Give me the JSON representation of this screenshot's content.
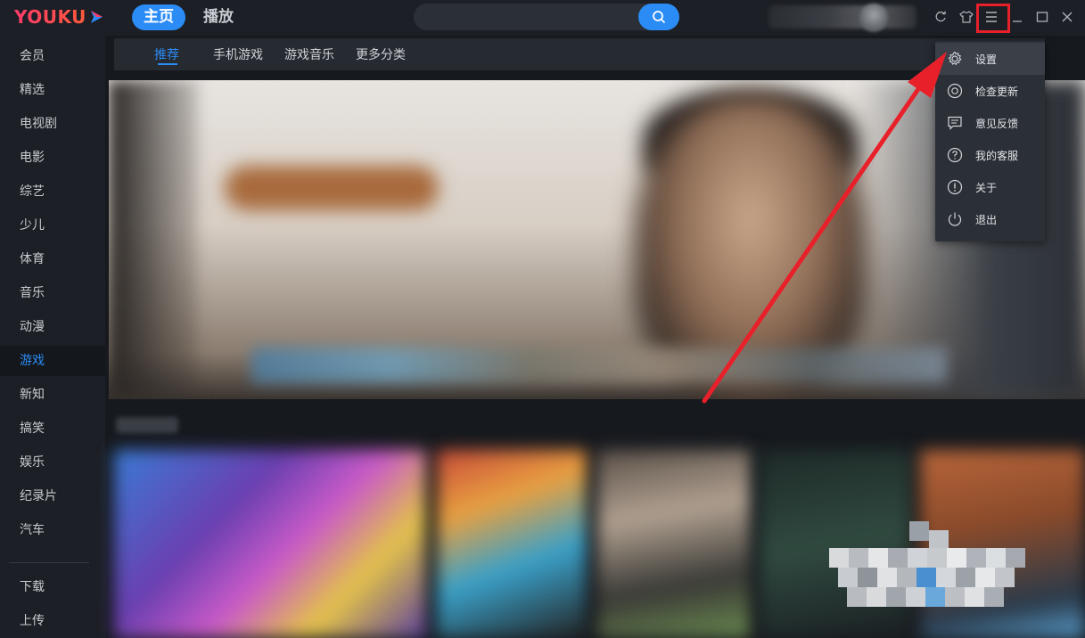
{
  "app": {
    "logo_text": "YOUKU",
    "brand_color": "#ff3b6b",
    "accent_color": "#2b8cf5"
  },
  "topbar": {
    "nav_home": "主页",
    "nav_play": "播放",
    "search": {
      "placeholder": "",
      "button_icon": "search-icon"
    },
    "icons": [
      "refresh-icon",
      "skin-icon",
      "menu-icon",
      "minimize-icon",
      "maximize-icon",
      "close-icon"
    ]
  },
  "sidebar": {
    "items": [
      {
        "label": "会员"
      },
      {
        "label": "精选"
      },
      {
        "label": "电视剧"
      },
      {
        "label": "电影"
      },
      {
        "label": "综艺"
      },
      {
        "label": "少儿"
      },
      {
        "label": "体育"
      },
      {
        "label": "音乐"
      },
      {
        "label": "动漫"
      },
      {
        "label": "游戏",
        "active": true
      },
      {
        "label": "新知"
      },
      {
        "label": "搞笑"
      },
      {
        "label": "娱乐"
      },
      {
        "label": "纪录片"
      },
      {
        "label": "汽车"
      }
    ],
    "bottom": [
      {
        "label": "下载"
      },
      {
        "label": "上传"
      }
    ]
  },
  "subnav": {
    "tabs": [
      {
        "label": "推荐",
        "active": true
      },
      {
        "label": "手机游戏"
      },
      {
        "label": "游戏音乐"
      },
      {
        "label": "更多分类"
      }
    ]
  },
  "dropdown": {
    "items": [
      {
        "label": "设置",
        "icon": "gear-icon",
        "active": true
      },
      {
        "label": "检查更新",
        "icon": "update-icon"
      },
      {
        "label": "意见反馈",
        "icon": "feedback-icon"
      },
      {
        "label": "我的客服",
        "icon": "help-icon"
      },
      {
        "label": "关于",
        "icon": "info-icon"
      },
      {
        "label": "退出",
        "icon": "power-icon"
      }
    ]
  },
  "annotation": {
    "highlight_color": "#e8202a"
  }
}
